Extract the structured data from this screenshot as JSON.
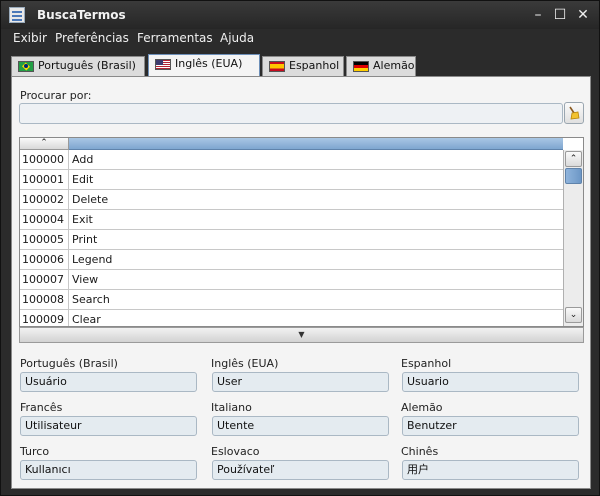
{
  "window": {
    "title": "BuscaTermos"
  },
  "titlebar": {
    "minimize": "–",
    "maximize": "☐",
    "close": "✕"
  },
  "menu": [
    "Exibir",
    "Preferências",
    "Ferramentas",
    "Ajuda"
  ],
  "tabs": [
    {
      "label": "Português (Brasil)",
      "icon": "brazil-flag-icon",
      "active": false
    },
    {
      "label": "Inglês (EUA)",
      "icon": "usa-flag-icon",
      "active": true
    },
    {
      "label": "Espanhol",
      "icon": "spain-flag-icon",
      "active": false
    },
    {
      "label": "Alemão",
      "icon": "germany-flag-icon",
      "active": false
    }
  ],
  "search": {
    "label": "Procurar por:",
    "value": "",
    "clear_icon": "broom-icon"
  },
  "table": {
    "sort_indicator": "⌃",
    "rows": [
      {
        "id": "100000",
        "term": "Add"
      },
      {
        "id": "100001",
        "term": "Edit"
      },
      {
        "id": "100002",
        "term": "Delete"
      },
      {
        "id": "100004",
        "term": "Exit"
      },
      {
        "id": "100005",
        "term": "Print"
      },
      {
        "id": "100006",
        "term": "Legend"
      },
      {
        "id": "100007",
        "term": "View"
      },
      {
        "id": "100008",
        "term": "Search"
      },
      {
        "id": "100009",
        "term": "Clear"
      }
    ]
  },
  "translations": [
    {
      "label": "Português (Brasil)",
      "value": "Usuário"
    },
    {
      "label": "Inglês (EUA)",
      "value": "User"
    },
    {
      "label": "Espanhol",
      "value": "Usuario"
    },
    {
      "label": "Francês",
      "value": "Utilisateur"
    },
    {
      "label": "Italiano",
      "value": "Utente"
    },
    {
      "label": "Alemão",
      "value": "Benutzer"
    },
    {
      "label": "Turco",
      "value": "Kullanıcı"
    },
    {
      "label": "Eslovaco",
      "value": "Používateľ"
    },
    {
      "label": "Chinês",
      "value": "用户"
    }
  ],
  "colors": {
    "accent": "#7ea6d0",
    "titlebar": "#2b2b2b",
    "field_bg": "#e4ebf0"
  }
}
